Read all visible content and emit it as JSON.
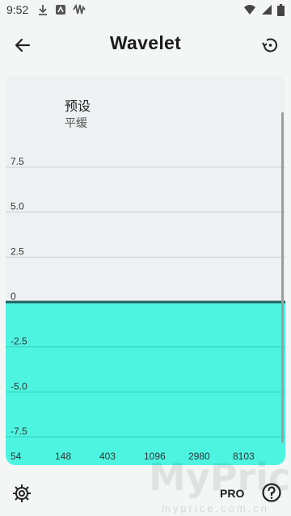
{
  "status_bar": {
    "time": "9:52",
    "left_icons": [
      "download-icon",
      "notification-icon",
      "waveform-icon"
    ],
    "right_icons": [
      "wifi-icon",
      "signal-icon",
      "battery-icon"
    ]
  },
  "app_bar": {
    "title": "Wavelet",
    "back_icon": "arrow-left-icon",
    "reset_icon": "history-icon"
  },
  "preset": {
    "label": "预设",
    "value": "平缓"
  },
  "bottom_bar": {
    "pro_label": "PRO",
    "settings_icon": "gear-icon",
    "help_icon": "help-circle-icon",
    "watermark": "MyPrice",
    "watermark_sub": "myprice.com.cn"
  },
  "colors": {
    "fill": "#4df5e1",
    "line": "#1f5e5b",
    "grid": "#c9cfcf",
    "card": "#edf1f1"
  },
  "chart_data": {
    "type": "area",
    "title": "",
    "xlabel": "",
    "ylabel": "",
    "y_ticks": [
      "7.5",
      "5.0",
      "2.5",
      "0",
      "-2.5",
      "-5.0",
      "-7.5"
    ],
    "ylim": [
      -8.5,
      9.5
    ],
    "x_ticks": [
      "54",
      "148",
      "403",
      "1096",
      "2980",
      "8103"
    ],
    "series": [
      {
        "values": [
          0,
          0,
          0,
          0,
          0,
          0
        ]
      }
    ],
    "grid": true
  }
}
